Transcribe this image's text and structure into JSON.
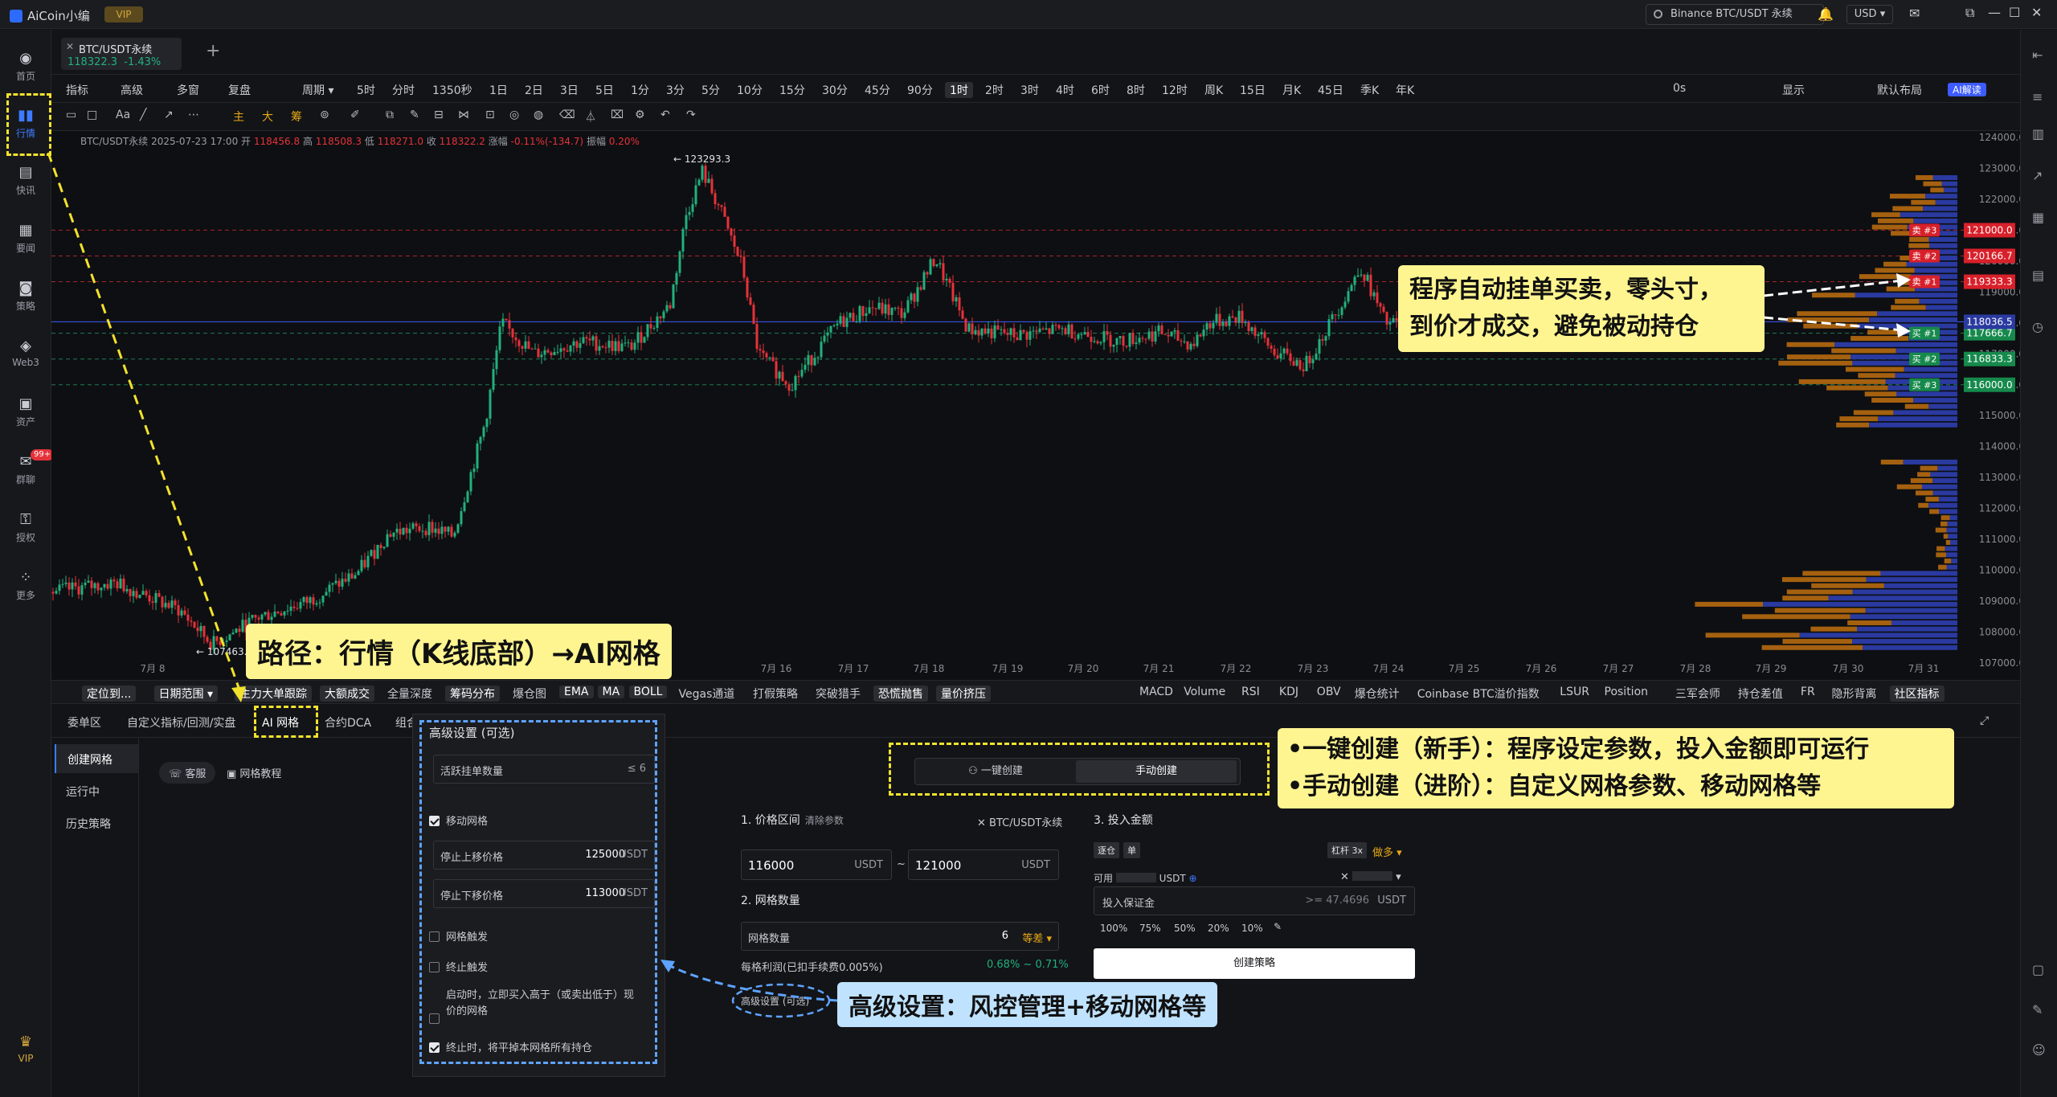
{
  "app": {
    "title": "AiCoin小编",
    "vip_label": "VIP"
  },
  "titlebar": {
    "search": "Binance BTC/USDT 永续",
    "currency": "USD ▾"
  },
  "sidebar": {
    "items": [
      {
        "label": "首页",
        "icon": "home-icon"
      },
      {
        "label": "行情",
        "icon": "chart-bars-icon"
      },
      {
        "label": "快讯",
        "icon": "news-icon"
      },
      {
        "label": "要闻",
        "icon": "doc-icon"
      },
      {
        "label": "策略",
        "icon": "robot-icon"
      },
      {
        "label": "Web3",
        "icon": "web3-icon"
      },
      {
        "label": "资产",
        "icon": "wallet-icon"
      },
      {
        "label": "群聊",
        "icon": "chat-icon",
        "badge": "99+"
      },
      {
        "label": "授权",
        "icon": "key-icon"
      },
      {
        "label": "更多",
        "icon": "grid-icon"
      }
    ],
    "vip": "VIP"
  },
  "symbol_tab": {
    "name": "BTC/USDT永续",
    "price": "118322.3",
    "change": "-1.43%"
  },
  "toolbar1": {
    "left": [
      "指标",
      "高级",
      "多窗",
      "复盘",
      "周期 ▾"
    ],
    "periods": [
      "5时",
      "分时",
      "1350秒",
      "1日",
      "2日",
      "3日",
      "5日",
      "1分",
      "3分",
      "5分",
      "10分",
      "15分",
      "30分",
      "45分",
      "90分",
      "1时",
      "2时",
      "3时",
      "4时",
      "6时",
      "8时",
      "12时",
      "周K",
      "15日",
      "月K",
      "45日",
      "季K",
      "年K"
    ],
    "active_period": "1时",
    "right": [
      "0s",
      "显示",
      "默认布局",
      "AI解读"
    ]
  },
  "toolbar2": {
    "gold": [
      "主",
      "大",
      "筹"
    ]
  },
  "chart_info": {
    "prefix": "BTC/USDT永续  2025-07-23 17:00  开",
    "open": "118456.8",
    "high_label": "高",
    "high": "118508.3",
    "low_label": "低",
    "low": "118271.0",
    "close_label": "收",
    "close": "118322.2",
    "chg_label": "涨幅",
    "chg": "-0.11%(-134.7)",
    "amp_label": "振幅",
    "amp": "0.20%"
  },
  "chart_data": {
    "type": "candlestick",
    "title": "BTC/USDT永续 1H",
    "x_dates": [
      "7月 8",
      "7月 16",
      "7月 17",
      "7月 18",
      "7月 19",
      "7月 20",
      "7月 21",
      "7月 22",
      "7月 23",
      "7月 24",
      "7月 25",
      "7月 26",
      "7月 27",
      "7月 28",
      "7月 29",
      "7月 30",
      "7月 31"
    ],
    "ylim": [
      107000,
      124000
    ],
    "y_ticks": [
      "124000.0",
      "123000.0",
      "122000.0",
      "121000.0",
      "120000.0",
      "119000.0",
      "118000.0",
      "117000.0",
      "116000.0",
      "115000.0",
      "114000.0",
      "113000.0",
      "112000.0",
      "111000.0",
      "110000.0",
      "109000.0",
      "108000.0",
      "107000.0"
    ],
    "annotations": {
      "high": "← 123293.3",
      "low": "← 107463.6"
    },
    "last_price": "118036.5",
    "sell_orders": [
      {
        "label": "卖 #3",
        "price": "121000.0"
      },
      {
        "label": "卖 #2",
        "price": "120166.7"
      },
      {
        "label": "卖 #1",
        "price": "119333.3"
      }
    ],
    "buy_orders": [
      {
        "label": "买 #1",
        "price": "117666.7"
      },
      {
        "label": "买 #2",
        "price": "116833.3"
      },
      {
        "label": "买 #3",
        "price": "116000.0"
      }
    ],
    "colors": {
      "up": "#22b07d",
      "down": "#e5323a",
      "volume_profile_buy": "#2a3aa0",
      "volume_profile_sell": "#a5610f"
    }
  },
  "indicators_left": [
    "定位到...",
    "日期范围 ▾",
    "主力大单跟踪",
    "大额成交",
    "全量深度",
    "筹码分布",
    "爆仓图",
    "EMA",
    "MA",
    "BOLL",
    "Vegas通道",
    "打假策略",
    "突破猎手",
    "恐慌抛售",
    "量价挤压"
  ],
  "indicators_right": [
    "MACD",
    "Volume",
    "RSI",
    "KDJ",
    "OBV",
    "爆仓统计",
    "Coinbase BTC溢价指数",
    "LSUR",
    "Position",
    "三军会师",
    "持仓差值",
    "FR",
    "隐形背离",
    "社区指标"
  ],
  "bottom_tabs": [
    "委单区",
    "自定义指标/回测/实盘",
    "AI 网格",
    "合约DCA",
    "组合"
  ],
  "bottom_subnav": [
    "创建网格",
    "运行中",
    "历史策略"
  ],
  "support": {
    "service": "客服",
    "tutorial": "网格教程"
  },
  "advanced": {
    "title": "高级设置 (可选)",
    "active_orders_label": "活跃挂单数量",
    "active_orders_value": "≤ 6",
    "moving_grid": "移动网格",
    "stop_upper_label": "停止上移价格",
    "stop_upper_value": "125000",
    "stop_lower_label": "停止下移价格",
    "stop_lower_value": "113000",
    "unit": "USDT",
    "grid_trigger": "网格触发",
    "stop_trigger": "终止触发",
    "start_buy_line1": "启动时，立即买入高于（或卖出低于）现",
    "start_buy_line2": "价的网格",
    "close_on_stop": "终止时，将平掉本网格所有持仓"
  },
  "grid_form": {
    "one_click": "一键创建",
    "manual": "手动创建",
    "section1": "1. 价格区间",
    "clear": "清除参数",
    "pair": "BTC/USDT永续",
    "lower": "116000",
    "upper": "121000",
    "unit": "USDT",
    "section2": "2. 网格数量",
    "grid_count_label": "网格数量",
    "grid_count": "6",
    "grid_mode": "等差 ▾",
    "profit_label": "每格利润(已扣手续费0.005%)",
    "profit_value": "0.68% ~ 0.71%",
    "advanced_label": "高级设置 (可选)",
    "section3": "3. 投入金额",
    "cross": "逐仓",
    "single": "单",
    "leverage": "杠杆 3x",
    "direction": "做多 ▾",
    "available_label": "可用",
    "margin_label": "投入保证金",
    "margin_hint": ">= 47.4696",
    "percents": [
      "100%",
      "75%",
      "50%",
      "20%",
      "10%"
    ],
    "create_btn": "创建策略"
  },
  "annotations": {
    "path": "路径：行情（K线底部）→AI网格",
    "orders_line1": "程序自动挂单买卖，零头寸，",
    "orders_line2": "到价才成交，避免被动持仓",
    "create_line1": "•一键创建（新手）：程序设定参数，投入金额即可运行",
    "create_line2": "•手动创建（进阶）：自定义网格参数、移动网格等",
    "advanced": "高级设置：风控管理+移动网格等"
  }
}
